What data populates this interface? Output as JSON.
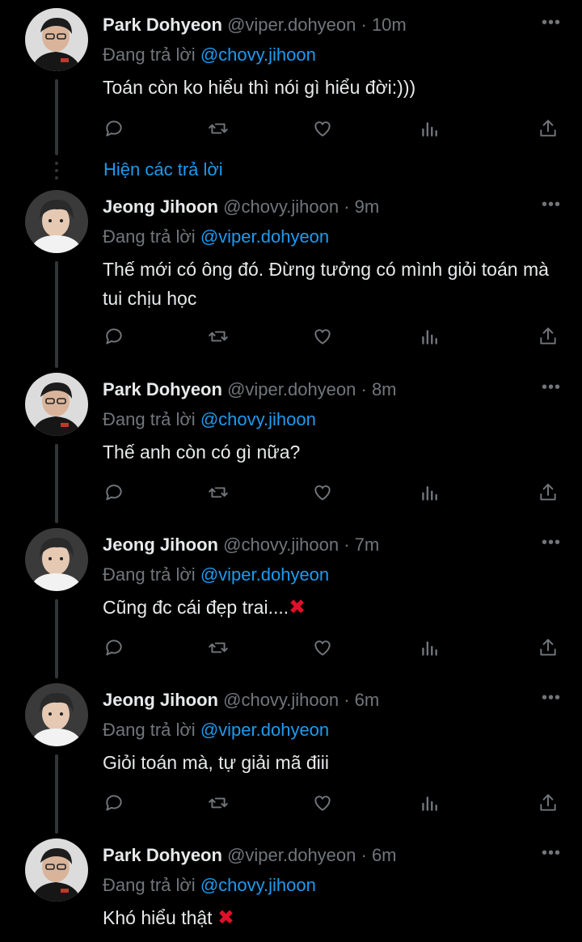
{
  "labels": {
    "replying_prefix": "Đang trả lời",
    "show_replies": "Hiện các trả lời"
  },
  "tweets": [
    {
      "name": "Park Dohyeon",
      "meta": "@viper.dohyeon · 10m",
      "mention": "@chovy.jihoon",
      "text": "Toán còn ko hiểu thì nói gì hiểu đời:)))",
      "x_mark": ""
    },
    {
      "name": "Jeong Jihoon",
      "meta": "@chovy.jihoon · 9m",
      "mention": "@viper.dohyeon",
      "text": "Thế mới có ông đó. Đừng tưởng có mình giỏi toán mà tui chịu học",
      "x_mark": ""
    },
    {
      "name": "Park Dohyeon",
      "meta": "@viper.dohyeon · 8m",
      "mention": "@chovy.jihoon",
      "text": "Thế anh còn có gì nữa?",
      "x_mark": ""
    },
    {
      "name": "Jeong Jihoon",
      "meta": "@chovy.jihoon · 7m",
      "mention": "@viper.dohyeon",
      "text": "Cũng đc cái đẹp trai....",
      "x_mark": "✖"
    },
    {
      "name": "Jeong Jihoon",
      "meta": "@chovy.jihoon · 6m",
      "mention": "@viper.dohyeon",
      "text": "Giỏi toán mà, tự giải mã điii",
      "x_mark": ""
    },
    {
      "name": "Park Dohyeon",
      "meta": "@viper.dohyeon · 6m",
      "mention": "@chovy.jihoon",
      "text": "Khó hiểu thật ",
      "x_mark": "✖"
    }
  ],
  "icons": {
    "reply": "reply-icon",
    "retweet": "retweet-icon",
    "like": "heart-icon",
    "views": "views-icon",
    "share": "share-icon",
    "more": "more-icon"
  },
  "colors": {
    "background": "#000000",
    "text": "#e7e9ea",
    "secondary": "#71767b",
    "link": "#1d9bf0",
    "x_mark": "#e0102a"
  }
}
